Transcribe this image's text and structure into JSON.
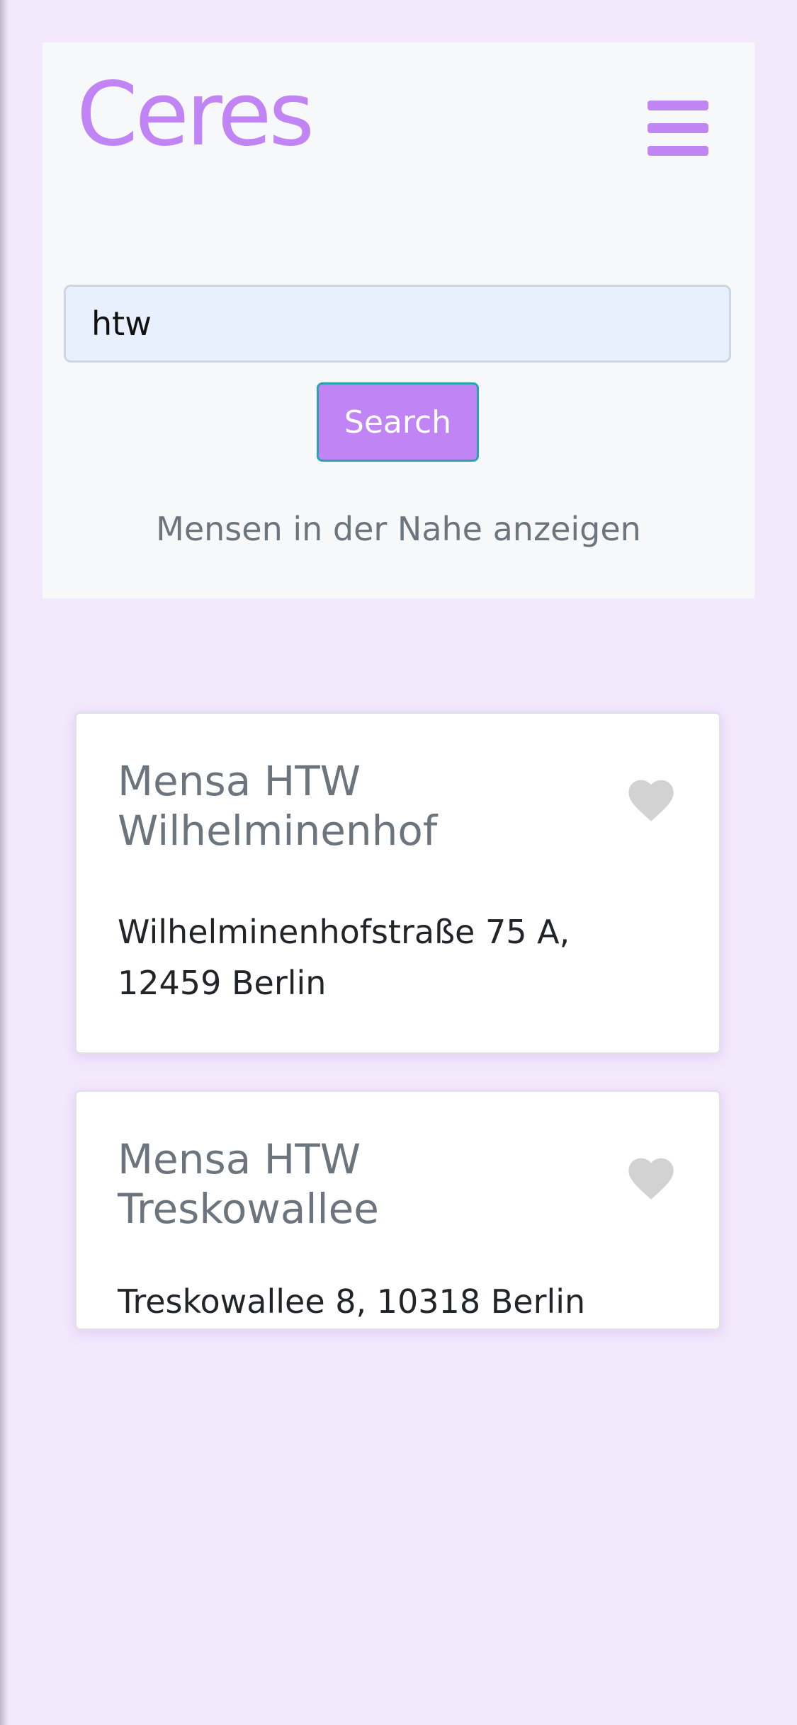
{
  "app": {
    "logo_text": "Ceres",
    "accent_color": "#c084f5",
    "menu_icon": "hamburger-menu-icon"
  },
  "search": {
    "value": "htw",
    "button_label": "Search",
    "nearby_link": "Mensen in der Nahe anzeigen"
  },
  "results": [
    {
      "name": "Mensa HTW Wilhelminenhof",
      "address": "Wilhelminenhofstraße 75 A, 12459 Berlin",
      "favorite_icon": "heart-icon",
      "favorited": false
    },
    {
      "name": "Mensa HTW Treskowallee",
      "address": "Treskowallee 8, 10318 Berlin",
      "favorite_icon": "heart-icon",
      "favorited": false
    }
  ]
}
